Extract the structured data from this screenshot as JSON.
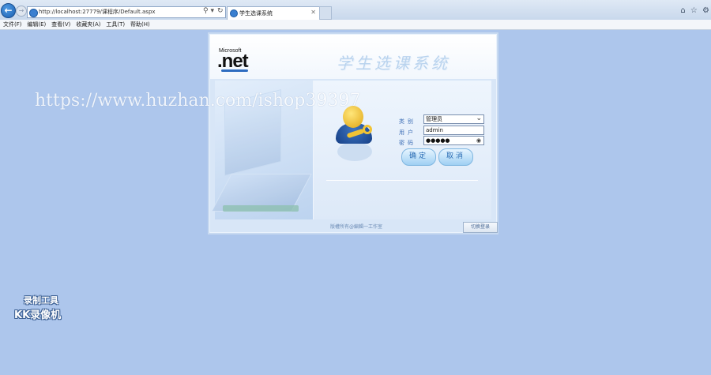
{
  "browser": {
    "url": "http://localhost:27779/课程序/Default.aspx",
    "tab_title": "学生选课系统",
    "tab_close": "✕",
    "back_glyph": "←",
    "forward_glyph": "→",
    "search_glyph": "⚲ ▾",
    "refresh_glyph": "↻",
    "tools": [
      "⌂",
      "☆",
      "⚙"
    ]
  },
  "menubar": {
    "items": [
      "文件(F)",
      "编辑(E)",
      "查看(V)",
      "收藏夹(A)",
      "工具(T)",
      "帮助(H)"
    ]
  },
  "login": {
    "ms_text": "Microsoft",
    "net_text": ".net",
    "system_title": "学生选课系统",
    "labels": {
      "type": "类别",
      "user": "用户",
      "password": "密码"
    },
    "type_value": "管理员",
    "user_value": "admin",
    "password_value": "●●●●●",
    "ok_label": "确定",
    "cancel_label": "取消",
    "footer_text": "版權所有@編輯一工作室",
    "corner_button": "切换登录"
  },
  "overlay": {
    "watermark": "https://www.huzhan.com/ishop39397",
    "recorder_line1": "录制工具",
    "recorder_line2": "KK录像机"
  },
  "colors": {
    "page_bg": "#adc6ec",
    "accent_blue": "#3e6fb6",
    "button_text": "#2b6db4"
  }
}
